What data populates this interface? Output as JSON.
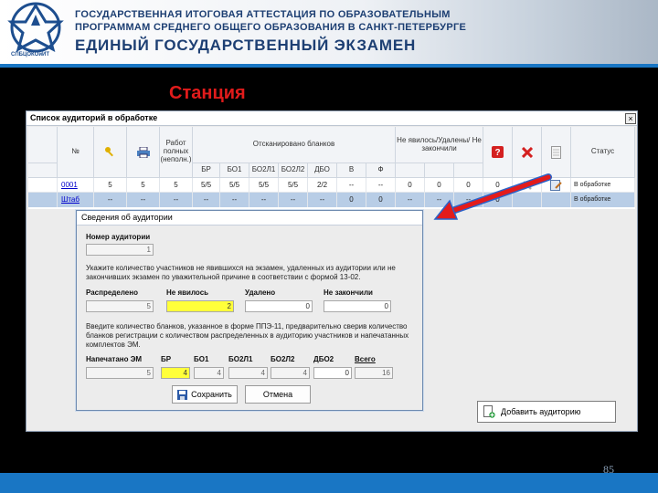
{
  "banner": {
    "line1": "ГОСУДАРСТВЕННАЯ ИТОГОВАЯ АТТЕСТАЦИЯ ПО ОБРАЗОВАТЕЛЬНЫМ",
    "line2": "ПРОГРАММАМ СРЕДНЕГО ОБЩЕГО ОБРАЗОВАНИЯ В САНКТ-ПЕТЕРБУРГЕ",
    "line3": "ЕДИНЫЙ ГОСУДАРСТВЕННЫЙ ЭКЗАМЕН",
    "logo_caption": "СПБЦОКОиИТ"
  },
  "station_title": "Станция",
  "page_number": "85",
  "window": {
    "title": "Список аудиторий в обработке",
    "close": "×",
    "headers": {
      "num": "№",
      "work": "Работ полных (неполн.)",
      "scanned": "Отсканировано бланков",
      "absent": "Не явилось/Удалены/ Не закончили",
      "status": "Статус",
      "sub": [
        "БР",
        "БО1",
        "БО2Л1",
        "БО2Л2",
        "ДБО",
        "В",
        "Ф"
      ]
    },
    "rows": [
      {
        "num": "0001",
        "key": "5",
        "print": "5",
        "work": "5",
        "br": "5/5",
        "bo1": "5/5",
        "bo2l1": "5/5",
        "bo2l2": "5/5",
        "dbo": "2/2",
        "v": "--",
        "f": "--",
        "a1": "0",
        "a2": "0",
        "a3": "0",
        "err": "0",
        "status": "В обработке"
      },
      {
        "num": "Штаб",
        "key": "--",
        "print": "--",
        "work": "--",
        "br": "--",
        "bo1": "--",
        "bo2l1": "--",
        "bo2l2": "--",
        "dbo": "--",
        "v": "0",
        "f": "0",
        "a1": "--",
        "a2": "--",
        "a3": "--",
        "err": "0",
        "status": "В обработке"
      }
    ],
    "add_button": "Добавить аудиторию"
  },
  "dialog": {
    "title": "Сведения об аудитории",
    "room_label": "Номер аудитории",
    "room_value": "1",
    "instruction1": "Укажите количество участников не явившихся на экзамен, удаленных из аудитории или не закончивших экзамен по уважительной причине в соответствии с формой 13-02.",
    "distributed_label": "Распределено",
    "distributed_value": "5",
    "absent_label": "Не явилось",
    "absent_value": "2",
    "removed_label": "Удалено",
    "removed_value": "0",
    "unfinished_label": "Не закончили",
    "unfinished_value": "0",
    "instruction2": "Введите количество бланков, указанное в форме ППЭ-11, предварительно сверив количество бланков регистрации с количеством распределенных в аудиторию участников и напечатанных комплектов ЭМ.",
    "printed_label": "Напечатано ЭМ",
    "printed_value": "5",
    "br_label": "БР",
    "br_value": "4",
    "bo1_label": "БО1",
    "bo1_value": "4",
    "bo2l1_label": "БО2Л1",
    "bo2l1_value": "4",
    "bo2l2_label": "БО2Л2",
    "bo2l2_value": "4",
    "dbo2_label": "ДБО2",
    "dbo2_value": "0",
    "total_label": "Всего",
    "total_value": "16",
    "save_button": "Сохранить",
    "cancel_button": "Отмена"
  },
  "colors": {
    "accent_blue": "#1976c4",
    "station_red": "#e11b1b",
    "highlight_yellow": "#ffff3a",
    "selected_row": "#b8cde6"
  }
}
